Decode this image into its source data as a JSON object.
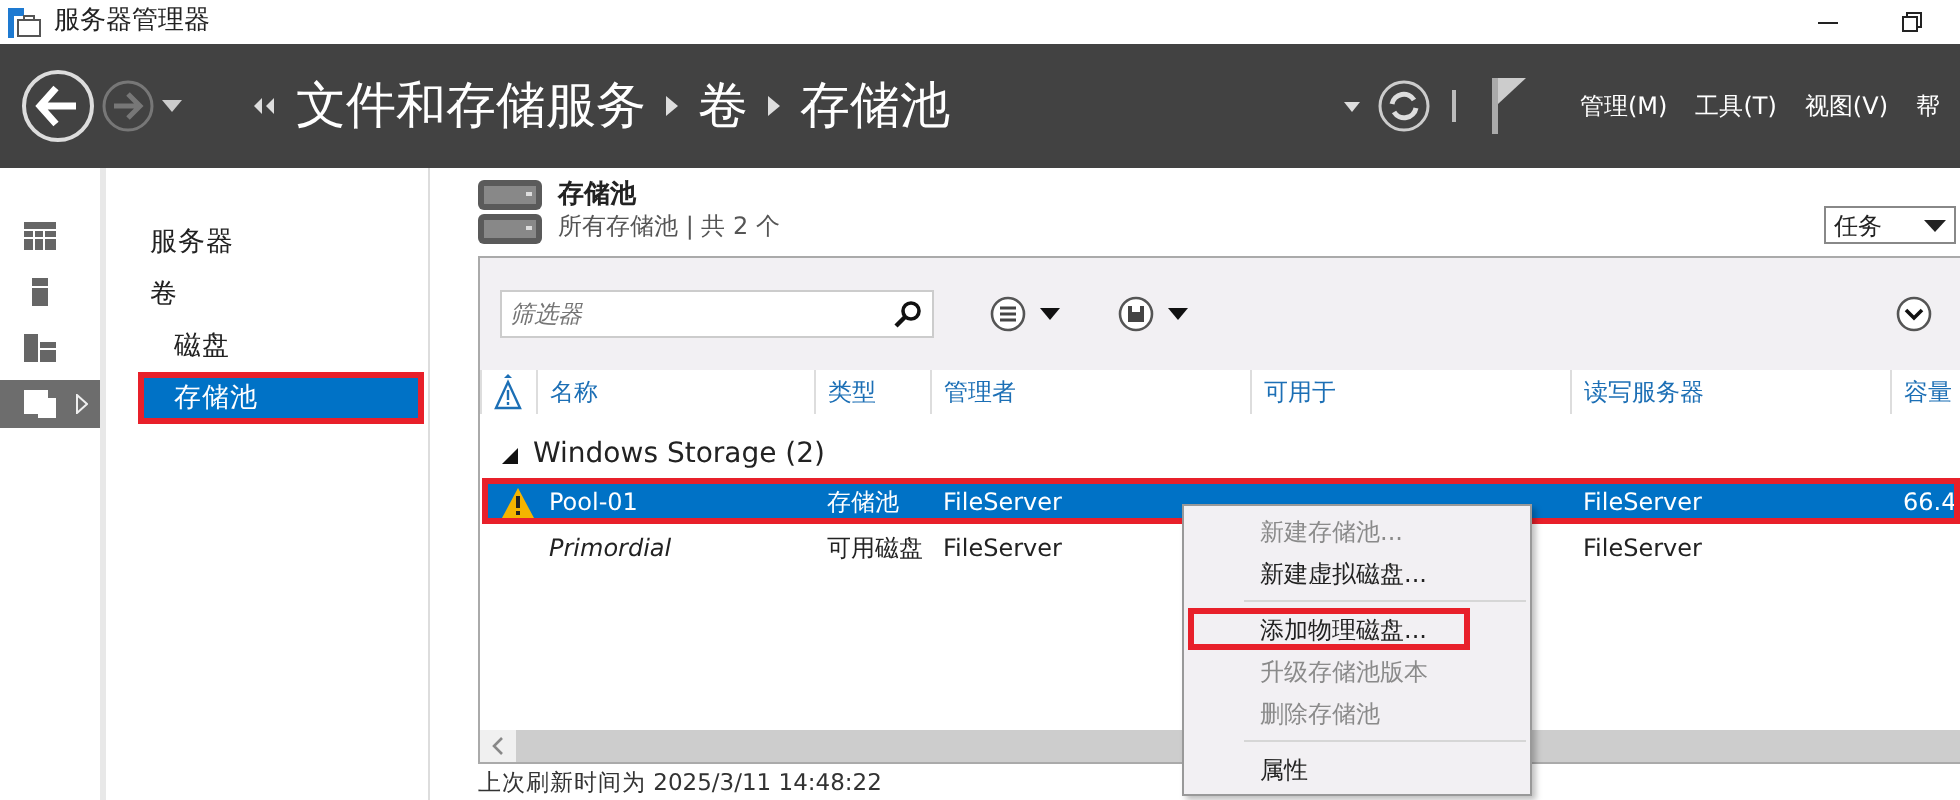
{
  "window": {
    "title": "服务器管理器"
  },
  "header": {
    "breadcrumb": [
      "文件和存储服务",
      "卷",
      "存储池"
    ],
    "menus": [
      "管理(M)",
      "工具(T)",
      "视图(V)",
      "帮"
    ]
  },
  "icon_strip": [
    {
      "kind": "dashboard",
      "selected": false
    },
    {
      "kind": "server",
      "selected": false
    },
    {
      "kind": "servers",
      "selected": false
    },
    {
      "kind": "files",
      "selected": true
    }
  ],
  "nav": [
    {
      "label": "服务器",
      "selected": false,
      "annotated": false
    },
    {
      "label": "卷",
      "selected": false,
      "annotated": false,
      "children": [
        {
          "label": "磁盘",
          "selected": false,
          "annotated": false
        },
        {
          "label": "存储池",
          "selected": true,
          "annotated": true
        }
      ]
    }
  ],
  "section": {
    "title": "存储池",
    "subtitle": "所有存储池 | 共 2 个",
    "tasks": "任务"
  },
  "filter": {
    "placeholder": "筛选器"
  },
  "table": {
    "columns": [
      "名称",
      "类型",
      "管理者",
      "可用于",
      "读写服务器",
      "容量"
    ],
    "group": {
      "label": "Windows Storage (2)",
      "expanded": true
    },
    "rows": [
      {
        "kind": "pool",
        "warning": true,
        "selected": true,
        "annotated": true,
        "cells": [
          "Pool-01",
          "存储池",
          "FileServer",
          null,
          "FileServer",
          "66.4"
        ]
      },
      {
        "kind": "primordial",
        "warning": false,
        "selected": false,
        "annotated": false,
        "cells": [
          "Primordial",
          "可用磁盘",
          "FileServer",
          null,
          "FileServer",
          null
        ]
      }
    ]
  },
  "context_menu": [
    {
      "kind": "item",
      "label": "新建存储池...",
      "disabled": true,
      "annotated": false
    },
    {
      "kind": "item",
      "label": "新建虚拟磁盘...",
      "disabled": false,
      "annotated": false
    },
    {
      "kind": "separator"
    },
    {
      "kind": "item",
      "label": "添加物理磁盘...",
      "disabled": false,
      "annotated": true
    },
    {
      "kind": "item",
      "label": "升级存储池版本",
      "disabled": true,
      "annotated": false
    },
    {
      "kind": "item",
      "label": "删除存储池",
      "disabled": true,
      "annotated": false
    },
    {
      "kind": "separator"
    },
    {
      "kind": "item",
      "label": "属性",
      "disabled": false,
      "annotated": false
    }
  ],
  "status_bar": "上次刷新时间为 2025/3/11 14:48:22"
}
